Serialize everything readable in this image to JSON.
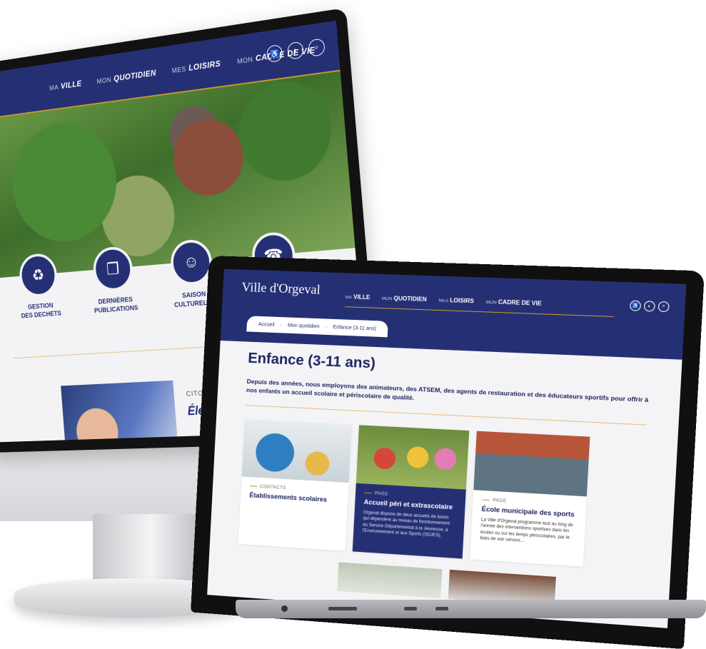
{
  "desktop": {
    "nav": [
      {
        "prefix": "MA",
        "label": "VILLE"
      },
      {
        "prefix": "MON",
        "label": "QUOTIDIEN"
      },
      {
        "prefix": "MES",
        "label": "LOISIRS"
      },
      {
        "prefix": "MON",
        "label": "CADRE DE VIE"
      }
    ],
    "categories": [
      {
        "icon": "recycle-icon",
        "label": "GESTION\nDES DECHETS"
      },
      {
        "icon": "book-icon",
        "label": "DERNIÈRES\nPUBLICATIONS"
      },
      {
        "icon": "theater-masks-icon",
        "label": "SAISON\nCULTURELLE"
      },
      {
        "icon": "contact-card-icon",
        "label": ""
      }
    ],
    "news": {
      "tag": "CITOYENNETÉ",
      "title": "Élections"
    }
  },
  "laptop": {
    "logo": "Ville d'Orgeval",
    "nav": [
      {
        "prefix": "MA",
        "label": "VILLE"
      },
      {
        "prefix": "MON",
        "label": "QUOTIDIEN"
      },
      {
        "prefix": "MES",
        "label": "LOISIRS"
      },
      {
        "prefix": "MON",
        "label": "CADRE DE VIE"
      }
    ],
    "breadcrumb": [
      "Accueil",
      "Mon quotidien",
      "Enfance (3-11 ans)"
    ],
    "title": "Enfance (3-11 ans)",
    "intro": "Depuis des années, nous employons des animateurs, des ATSEM, des agents de restauration et des éducateurs sportifs pour offrir à nos enfants un accueil scolaire et périscolaire de qualité.",
    "cards": [
      {
        "tag": "CONTACTS",
        "title": "Établissements scolaires",
        "desc": ""
      },
      {
        "tag": "PAGE",
        "title": "Accueil péri et extrascolaire",
        "desc": "Orgeval dispose de deux accueils de loisirs qui dépendent au niveau de fonctionnement du Service Départemental à la Jeunesse, à l'Environnement et aux Sports (SDJES)."
      },
      {
        "tag": "PAGE",
        "title": "École municipale des sports",
        "desc": "La Ville d'Orgeval programme tout au long de l'année des interventions sportives dans les écoles ou sur les temps périscolaires, par le biais de son service..."
      }
    ]
  },
  "colors": {
    "brand_navy": "#253074",
    "accent_gold": "#c8962e"
  }
}
